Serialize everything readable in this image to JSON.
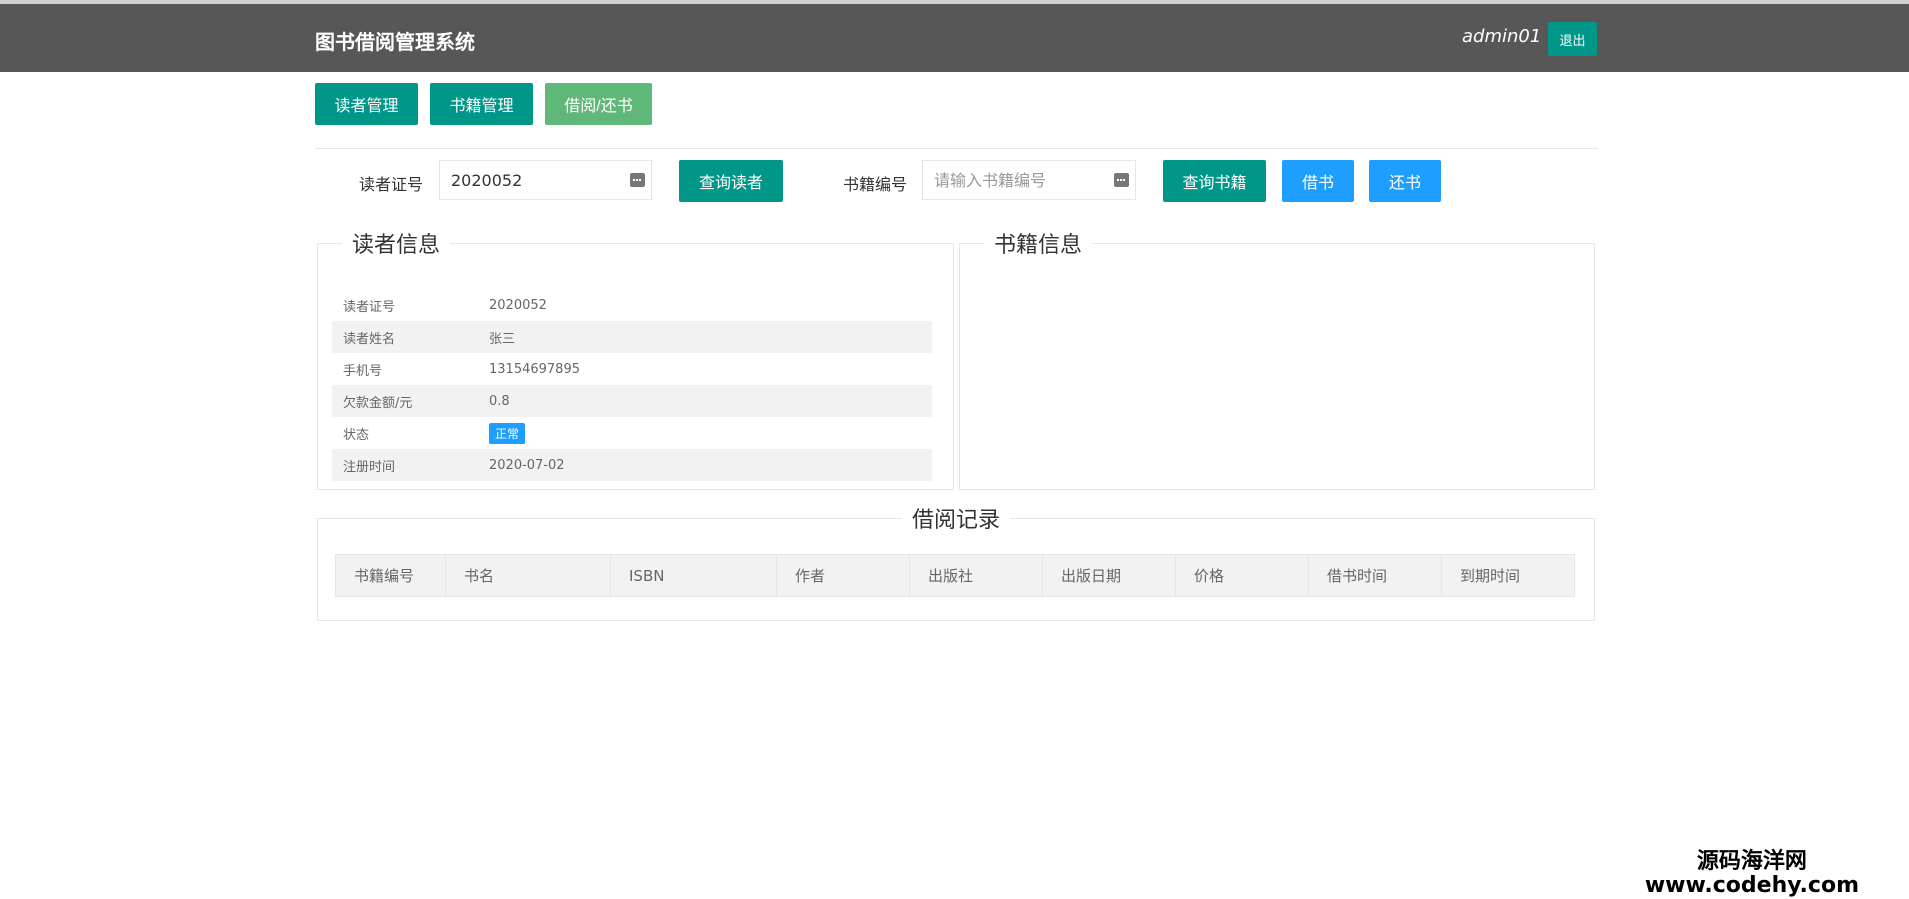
{
  "header": {
    "title": "图书借阅管理系统",
    "user": "admin01",
    "logout_label": "退出"
  },
  "nav": {
    "reader_label": "读者管理",
    "book_label": "书籍管理",
    "borrow_label": "借阅/还书"
  },
  "search": {
    "reader_id_label": "读者证号",
    "reader_id_value": "2020052",
    "query_reader_label": "查询读者",
    "book_id_label": "书籍编号",
    "book_id_placeholder": "请输入书籍编号",
    "query_book_label": "查询书籍",
    "borrow_label": "借书",
    "return_label": "还书"
  },
  "reader_info": {
    "legend": "读者信息",
    "rows": [
      {
        "key": "读者证号",
        "value": "2020052"
      },
      {
        "key": "读者姓名",
        "value": "张三"
      },
      {
        "key": "手机号",
        "value": "13154697895"
      },
      {
        "key": "欠款金额/元",
        "value": "0.8"
      },
      {
        "key": "状态",
        "value": "正常"
      },
      {
        "key": "注册时间",
        "value": "2020-07-02"
      }
    ]
  },
  "book_info": {
    "legend": "书籍信息"
  },
  "records": {
    "legend": "借阅记录",
    "columns": [
      "书籍编号",
      "书名",
      "ISBN",
      "作者",
      "出版社",
      "出版日期",
      "价格",
      "借书时间",
      "到期时间"
    ]
  },
  "watermark": {
    "cn": "源码海洋网",
    "url": "www.codehy.com"
  },
  "colors": {
    "header_bg": "#575757",
    "primary": "#009688",
    "primary_light": "#5fb878",
    "blue": "#1e9fff"
  }
}
